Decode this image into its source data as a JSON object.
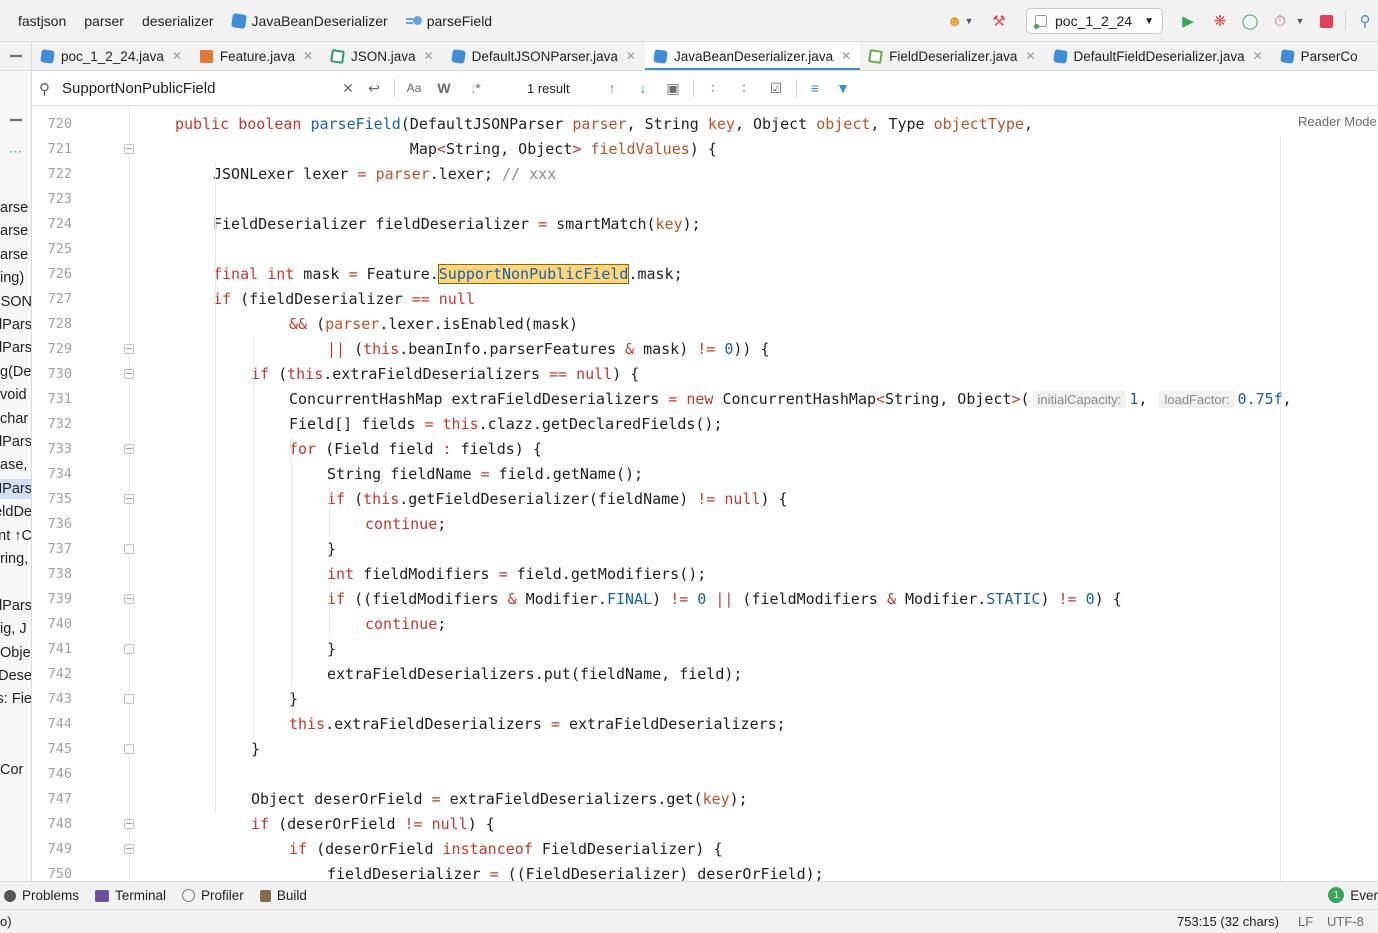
{
  "colors": {
    "accent": "#3f8dd6",
    "keyword": "#c0392b",
    "param": "#b5552a",
    "number": "#1a5fb4",
    "highlight": "#ffd77a"
  },
  "breadcrumbs": [
    "fastjson",
    "parser",
    "deserializer",
    "JavaBeanDeserializer",
    "parseField"
  ],
  "toolbar": {
    "run_config": "poc_1_2_24",
    "icons": [
      "user-icon",
      "hammer-icon",
      "run-icon",
      "debug-icon",
      "coverage-icon",
      "profile-icon",
      "stop-icon",
      "search-icon"
    ]
  },
  "tabs": [
    {
      "label": "poc_1_2_24.java",
      "icon": "class",
      "active": false
    },
    {
      "label": "Feature.java",
      "icon": "feat",
      "active": false
    },
    {
      "label": "JSON.java",
      "icon": "json",
      "active": false
    },
    {
      "label": "DefaultJSONParser.java",
      "icon": "class",
      "active": false
    },
    {
      "label": "JavaBeanDeserializer.java",
      "icon": "class",
      "active": true
    },
    {
      "label": "FieldDeserializer.java",
      "icon": "field",
      "active": false
    },
    {
      "label": "DefaultFieldDeserializer.java",
      "icon": "class",
      "active": false
    },
    {
      "label": "ParserCo",
      "icon": "class",
      "active": false
    }
  ],
  "search": {
    "query": "SupportNonPublicField",
    "result_count": "1 result",
    "match_case": "Aa",
    "words": "W",
    "regex": ".*"
  },
  "left_pane": [
    "arse",
    "arse",
    "arse",
    "ing)",
    "JSON",
    "lPars",
    "lPars",
    "g(De",
    "void",
    "char",
    "lPars",
    "ase,",
    "NPars",
    "eldDe",
    "nt ↑C",
    "ring,",
    "",
    "lPars",
    "ig, J",
    "Obje",
    "Dese",
    "s: Fie",
    "",
    "",
    "Cor"
  ],
  "editor": {
    "reader_mode": "Reader Mode",
    "lines": [
      {
        "n": "720",
        "indent": 0,
        "segs": [
          [
            "k",
            "public"
          ],
          [
            "t",
            " "
          ],
          [
            "k",
            "boolean"
          ],
          [
            "t",
            " "
          ],
          [
            "f",
            "parseField"
          ],
          [
            "t",
            "(DefaultJSONParser "
          ],
          [
            "p",
            "parser"
          ],
          [
            "t",
            ", String "
          ],
          [
            "p",
            "key"
          ],
          [
            "t",
            ", Object "
          ],
          [
            "p",
            "object"
          ],
          [
            "t",
            ", Type "
          ],
          [
            "p",
            "objectType"
          ],
          [
            "t",
            ","
          ]
        ]
      },
      {
        "n": "721",
        "indent": 0,
        "segs": [
          [
            "t",
            "                          Map"
          ],
          [
            "k",
            "<"
          ],
          [
            "t",
            "String, Object"
          ],
          [
            "k",
            ">"
          ],
          [
            "t",
            " "
          ],
          [
            "p",
            "fieldValues"
          ],
          [
            "t",
            ") {"
          ]
        ]
      },
      {
        "n": "722",
        "indent": 1,
        "segs": [
          [
            "t",
            "JSONLexer lexer "
          ],
          [
            "k",
            "="
          ],
          [
            "t",
            " "
          ],
          [
            "p",
            "parser"
          ],
          [
            "t",
            ".lexer; "
          ],
          [
            "c",
            "// xxx"
          ]
        ]
      },
      {
        "n": "723",
        "indent": 0,
        "segs": []
      },
      {
        "n": "724",
        "indent": 1,
        "segs": [
          [
            "t",
            "FieldDeserializer fieldDeserializer "
          ],
          [
            "k",
            "="
          ],
          [
            "t",
            " smartMatch("
          ],
          [
            "p",
            "key"
          ],
          [
            "t",
            ");"
          ]
        ]
      },
      {
        "n": "725",
        "indent": 0,
        "segs": []
      },
      {
        "n": "726",
        "indent": 1,
        "segs": [
          [
            "k",
            "final"
          ],
          [
            "t",
            " "
          ],
          [
            "k",
            "int"
          ],
          [
            "t",
            " mask "
          ],
          [
            "k",
            "="
          ],
          [
            "t",
            " Feature."
          ],
          [
            "h",
            "SupportNonPublicField"
          ],
          [
            "t",
            ".mask;"
          ]
        ]
      },
      {
        "n": "727",
        "indent": 1,
        "segs": [
          [
            "k",
            "if"
          ],
          [
            "t",
            " (fieldDeserializer "
          ],
          [
            "k",
            "=="
          ],
          [
            "t",
            " "
          ],
          [
            "k",
            "null"
          ]
        ]
      },
      {
        "n": "728",
        "indent": 3,
        "segs": [
          [
            "k",
            "&&"
          ],
          [
            "t",
            " ("
          ],
          [
            "p",
            "parser"
          ],
          [
            "t",
            ".lexer.isEnabled(mask)"
          ]
        ]
      },
      {
        "n": "729",
        "indent": 4,
        "segs": [
          [
            "k",
            "||"
          ],
          [
            "t",
            " ("
          ],
          [
            "k",
            "this"
          ],
          [
            "t",
            ".beanInfo.parserFeatures "
          ],
          [
            "k",
            "&"
          ],
          [
            "t",
            " mask) "
          ],
          [
            "k",
            "!="
          ],
          [
            "t",
            " "
          ],
          [
            "n",
            "0"
          ],
          [
            "t",
            ")) {"
          ]
        ]
      },
      {
        "n": "730",
        "indent": 2,
        "segs": [
          [
            "k",
            "if"
          ],
          [
            "t",
            " ("
          ],
          [
            "k",
            "this"
          ],
          [
            "t",
            ".extraFieldDeserializers "
          ],
          [
            "k",
            "=="
          ],
          [
            "t",
            " "
          ],
          [
            "k",
            "null"
          ],
          [
            "t",
            ") {"
          ]
        ]
      },
      {
        "n": "731",
        "indent": 3,
        "segs": [
          [
            "t",
            "ConcurrentHashMap extraFieldDeserializers "
          ],
          [
            "k",
            "="
          ],
          [
            "t",
            " "
          ],
          [
            "k",
            "new"
          ],
          [
            "t",
            " ConcurrentHashMap"
          ],
          [
            "k",
            "<"
          ],
          [
            "t",
            "String, Object"
          ],
          [
            "k",
            ">"
          ],
          [
            "t",
            "("
          ],
          [
            "i",
            "initialCapacity:"
          ],
          [
            "n",
            "1"
          ],
          [
            "t",
            ", "
          ],
          [
            "i",
            "loadFactor:"
          ],
          [
            "n",
            "0.75f"
          ],
          [
            "t",
            ","
          ]
        ]
      },
      {
        "n": "732",
        "indent": 3,
        "segs": [
          [
            "t",
            "Field[] fields "
          ],
          [
            "k",
            "="
          ],
          [
            "t",
            " "
          ],
          [
            "k",
            "this"
          ],
          [
            "t",
            ".clazz.getDeclaredFields();"
          ]
        ]
      },
      {
        "n": "733",
        "indent": 3,
        "segs": [
          [
            "k",
            "for"
          ],
          [
            "t",
            " (Field field "
          ],
          [
            "k",
            ":"
          ],
          [
            "t",
            " fields) {"
          ]
        ]
      },
      {
        "n": "734",
        "indent": 4,
        "segs": [
          [
            "t",
            "String fieldName "
          ],
          [
            "k",
            "="
          ],
          [
            "t",
            " field.getName();"
          ]
        ]
      },
      {
        "n": "735",
        "indent": 4,
        "segs": [
          [
            "k",
            "if"
          ],
          [
            "t",
            " ("
          ],
          [
            "k",
            "this"
          ],
          [
            "t",
            ".getFieldDeserializer(fieldName) "
          ],
          [
            "k",
            "!="
          ],
          [
            "t",
            " "
          ],
          [
            "k",
            "null"
          ],
          [
            "t",
            ") {"
          ]
        ]
      },
      {
        "n": "736",
        "indent": 5,
        "segs": [
          [
            "k",
            "continue"
          ],
          [
            "t",
            ";"
          ]
        ]
      },
      {
        "n": "737",
        "indent": 4,
        "segs": [
          [
            "t",
            "}"
          ]
        ]
      },
      {
        "n": "738",
        "indent": 4,
        "segs": [
          [
            "k",
            "int"
          ],
          [
            "t",
            " fieldModifiers "
          ],
          [
            "k",
            "="
          ],
          [
            "t",
            " field.getModifiers();"
          ]
        ]
      },
      {
        "n": "739",
        "indent": 4,
        "segs": [
          [
            "k",
            "if"
          ],
          [
            "t",
            " ((fieldModifiers "
          ],
          [
            "k",
            "&"
          ],
          [
            "t",
            " Modifier."
          ],
          [
            "n",
            "FINAL"
          ],
          [
            "t",
            ") "
          ],
          [
            "k",
            "!="
          ],
          [
            "t",
            " "
          ],
          [
            "n",
            "0"
          ],
          [
            "t",
            " "
          ],
          [
            "k",
            "||"
          ],
          [
            "t",
            " (fieldModifiers "
          ],
          [
            "k",
            "&"
          ],
          [
            "t",
            " Modifier."
          ],
          [
            "n",
            "STATIC"
          ],
          [
            "t",
            ") "
          ],
          [
            "k",
            "!="
          ],
          [
            "t",
            " "
          ],
          [
            "n",
            "0"
          ],
          [
            "t",
            ") {"
          ]
        ]
      },
      {
        "n": "740",
        "indent": 5,
        "segs": [
          [
            "k",
            "continue"
          ],
          [
            "t",
            ";"
          ]
        ]
      },
      {
        "n": "741",
        "indent": 4,
        "segs": [
          [
            "t",
            "}"
          ]
        ]
      },
      {
        "n": "742",
        "indent": 4,
        "segs": [
          [
            "t",
            "extraFieldDeserializers.put(fieldName, field);"
          ]
        ]
      },
      {
        "n": "743",
        "indent": 3,
        "segs": [
          [
            "t",
            "}"
          ]
        ]
      },
      {
        "n": "744",
        "indent": 3,
        "segs": [
          [
            "k",
            "this"
          ],
          [
            "t",
            ".extraFieldDeserializers "
          ],
          [
            "k",
            "="
          ],
          [
            "t",
            " extraFieldDeserializers;"
          ]
        ]
      },
      {
        "n": "745",
        "indent": 2,
        "segs": [
          [
            "t",
            "}"
          ]
        ]
      },
      {
        "n": "746",
        "indent": 0,
        "segs": []
      },
      {
        "n": "747",
        "indent": 2,
        "segs": [
          [
            "t",
            "Object deserOrField "
          ],
          [
            "k",
            "="
          ],
          [
            "t",
            " extraFieldDeserializers.get("
          ],
          [
            "p",
            "key"
          ],
          [
            "t",
            ");"
          ]
        ]
      },
      {
        "n": "748",
        "indent": 2,
        "segs": [
          [
            "k",
            "if"
          ],
          [
            "t",
            " (deserOrField "
          ],
          [
            "k",
            "!="
          ],
          [
            "t",
            " "
          ],
          [
            "k",
            "null"
          ],
          [
            "t",
            ") {"
          ]
        ]
      },
      {
        "n": "749",
        "indent": 3,
        "segs": [
          [
            "k",
            "if"
          ],
          [
            "t",
            " (deserOrField "
          ],
          [
            "k",
            "instanceof"
          ],
          [
            "t",
            " FieldDeserializer) {"
          ]
        ]
      },
      {
        "n": "750",
        "indent": 4,
        "segs": [
          [
            "t",
            "fieldDeserializer "
          ],
          [
            "k",
            "="
          ],
          [
            "t",
            " ((FieldDeserializer) deserOrField);"
          ]
        ]
      }
    ]
  },
  "tool_windows": [
    {
      "label": "Problems",
      "icon": "problems-icon"
    },
    {
      "label": "Terminal",
      "icon": "terminal-icon"
    },
    {
      "label": "Profiler",
      "icon": "profiler-icon"
    },
    {
      "label": "Build",
      "icon": "build-icon"
    }
  ],
  "event_log": {
    "count": "1",
    "label": "Ever"
  },
  "status": {
    "left": "o)",
    "position": "753:15 (32 chars)",
    "line_sep": "LF",
    "encoding": "UTF-8"
  }
}
